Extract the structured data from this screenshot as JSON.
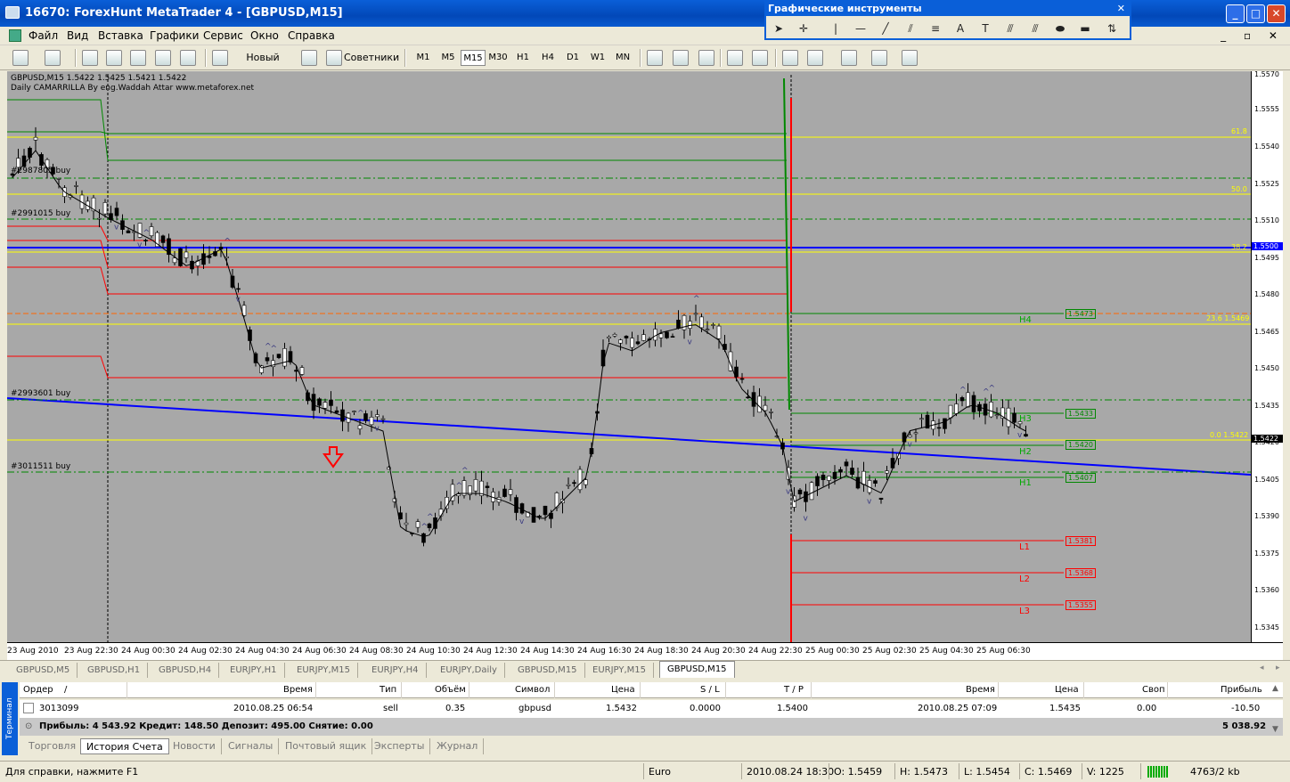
{
  "window": {
    "title": "16670: ForexHunt MetaTrader 4 - [GBPUSD,M15]"
  },
  "menu": [
    "Файл",
    "Вид",
    "Вставка",
    "Графики",
    "Сервис",
    "Окно",
    "Справка"
  ],
  "toolbar": {
    "new_order": "Новый Ордер",
    "experts": "Советники",
    "timeframes": [
      "M1",
      "M5",
      "M15",
      "M30",
      "H1",
      "H4",
      "D1",
      "W1",
      "MN"
    ],
    "active_tf": "M15"
  },
  "graph_tools": {
    "title": "Графические инструменты"
  },
  "chart": {
    "symbol_line": "GBPUSD,M15  1.5422 1.5425 1.5421 1.5422",
    "indicator_line": "Daily  CAMARRILLA By eng.Waddah Attar www.metaforex.net",
    "order_labels": [
      "#2987805 buy",
      "#2991015 buy",
      "#2993601 buy",
      "#3011511 buy"
    ],
    "fib_labels": [
      "61.8",
      "50.0",
      "38.2",
      "23.6 1.5469",
      "0.0 1.5422"
    ],
    "levels": [
      {
        "name": "H4",
        "price": "1.5473"
      },
      {
        "name": "H3",
        "price": "1.5433"
      },
      {
        "name": "H2",
        "price": "1.5420"
      },
      {
        "name": "H1",
        "price": "1.5407"
      },
      {
        "name": "L1",
        "price": "1.5381"
      },
      {
        "name": "L2",
        "price": "1.5368"
      },
      {
        "name": "L3",
        "price": "1.5355"
      }
    ],
    "price_axis": [
      "1.5570",
      "1.5555",
      "1.5540",
      "1.5525",
      "1.5510",
      "1.5495",
      "1.5480",
      "1.5465",
      "1.5450",
      "1.5435",
      "1.5420",
      "1.5405",
      "1.5390",
      "1.5375",
      "1.5360",
      "1.5345"
    ],
    "current_price": "1.5422",
    "line_price": "1.5500",
    "time_axis": [
      "23 Aug 2010",
      "23 Aug 22:30",
      "24 Aug 00:30",
      "24 Aug 02:30",
      "24 Aug 04:30",
      "24 Aug 06:30",
      "24 Aug 08:30",
      "24 Aug 10:30",
      "24 Aug 12:30",
      "24 Aug 14:30",
      "24 Aug 16:30",
      "24 Aug 18:30",
      "24 Aug 20:30",
      "24 Aug 22:30",
      "25 Aug 00:30",
      "25 Aug 02:30",
      "25 Aug 04:30",
      "25 Aug 06:30"
    ],
    "colors": {
      "bg": "#a8a8a8",
      "trend": "#0000ff",
      "green": "#008000",
      "red": "#ff0000",
      "yellow": "#ffff00"
    }
  },
  "chart_tabs": [
    "GBPUSD,M5",
    "GBPUSD,H1",
    "GBPUSD,H4",
    "EURJPY,H1",
    "EURJPY,M15",
    "EURJPY,H4",
    "EURJPY,Daily",
    "GBPUSD,M15",
    "EURJPY,M15",
    "GBPUSD,M15"
  ],
  "active_chart_tab": "GBPUSD,M15",
  "terminal": {
    "side_label": "Терминал",
    "headers": [
      "Ордер",
      "/",
      "Время",
      "Тип",
      "Объём",
      "Символ",
      "Цена",
      "S / L",
      "T / P",
      "Время",
      "Цена",
      "Своп",
      "Прибыль"
    ],
    "row": [
      "3013099",
      "2010.08.25 06:54",
      "sell",
      "0.35",
      "gbpusd",
      "1.5432",
      "0.0000",
      "1.5400",
      "2010.08.25 07:09",
      "1.5435",
      "0.00",
      "-10.50"
    ],
    "summary": "Прибыль: 4 543.92  Кредит: 148.50  Депозит: 495.00  Снятие: 0.00",
    "total": "5 038.92",
    "tabs": [
      "Торговля",
      "История Счета",
      "Новости",
      "Сигналы",
      "Почтовый ящик",
      "Эксперты",
      "Журнал"
    ],
    "active_tab": "История Счета"
  },
  "status": {
    "help": "Для справки, нажмите F1",
    "profile": "Euro",
    "time": "2010.08.24 18:30",
    "open": "O: 1.5459",
    "high": "H: 1.5473",
    "low": "L: 1.5454",
    "close": "C: 1.5469",
    "volume": "V: 1225",
    "traffic": "4763/2 kb"
  }
}
